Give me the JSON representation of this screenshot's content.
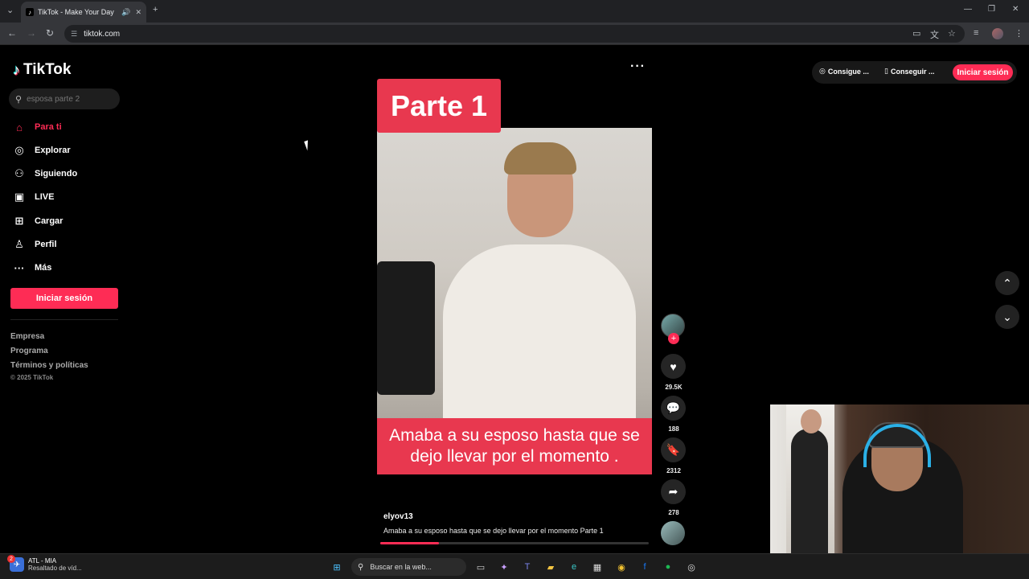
{
  "browser": {
    "tab_title": "TikTok - Make Your Day",
    "url": "tiktok.com",
    "icons": {
      "tab_favicon": "tiktok-icon",
      "tab_audio": "speaker-icon",
      "tab_close": "close-icon",
      "new_tab": "plus-icon",
      "back": "back-arrow-icon",
      "forward": "forward-arrow-icon",
      "reload": "reload-icon",
      "site_info": "tune-icon",
      "cast": "cast-icon",
      "translate": "translate-icon",
      "bookmark": "star-icon",
      "media": "media-icon",
      "menu": "kebab-icon"
    }
  },
  "sidebar": {
    "logo": "TikTok",
    "search_placeholder": "esposa parte 2",
    "items": [
      {
        "label": "Para ti",
        "icon": "home-icon",
        "active": true
      },
      {
        "label": "Explorar",
        "icon": "compass-icon"
      },
      {
        "label": "Siguiendo",
        "icon": "following-icon"
      },
      {
        "label": "LIVE",
        "icon": "live-icon"
      },
      {
        "label": "Cargar",
        "icon": "upload-icon"
      },
      {
        "label": "Perfil",
        "icon": "profile-icon"
      },
      {
        "label": "Más",
        "icon": "more-icon"
      }
    ],
    "login_label": "Iniciar sesión",
    "footer_links": [
      "Empresa",
      "Programa",
      "Términos y políticas"
    ],
    "copyright": "© 2025 TikTok"
  },
  "video": {
    "badge": "Parte 1",
    "caption_overlay": "Amaba a su esposo hasta que se dejo llevar por el momento .",
    "author": "elyov13",
    "description": "Amaba a su esposo hasta que se dejo llevar por el momento Parte 1",
    "progress": 0.22,
    "likes": "29.5K",
    "comments": "188",
    "saves": "2312",
    "shares": "278"
  },
  "topbar": {
    "btn1": "Consigue ...",
    "btn2": "Conseguir ...",
    "login": "Iniciar sesión"
  },
  "taskbar": {
    "weather_line1": "ATL - MIA",
    "weather_line2": "Resaltado de víd...",
    "badge": "2",
    "search_placeholder": "Buscar en la web..."
  },
  "colors": {
    "accent": "#fe2c55",
    "caption_bg": "#e8384f",
    "page_bg": "#000000"
  }
}
